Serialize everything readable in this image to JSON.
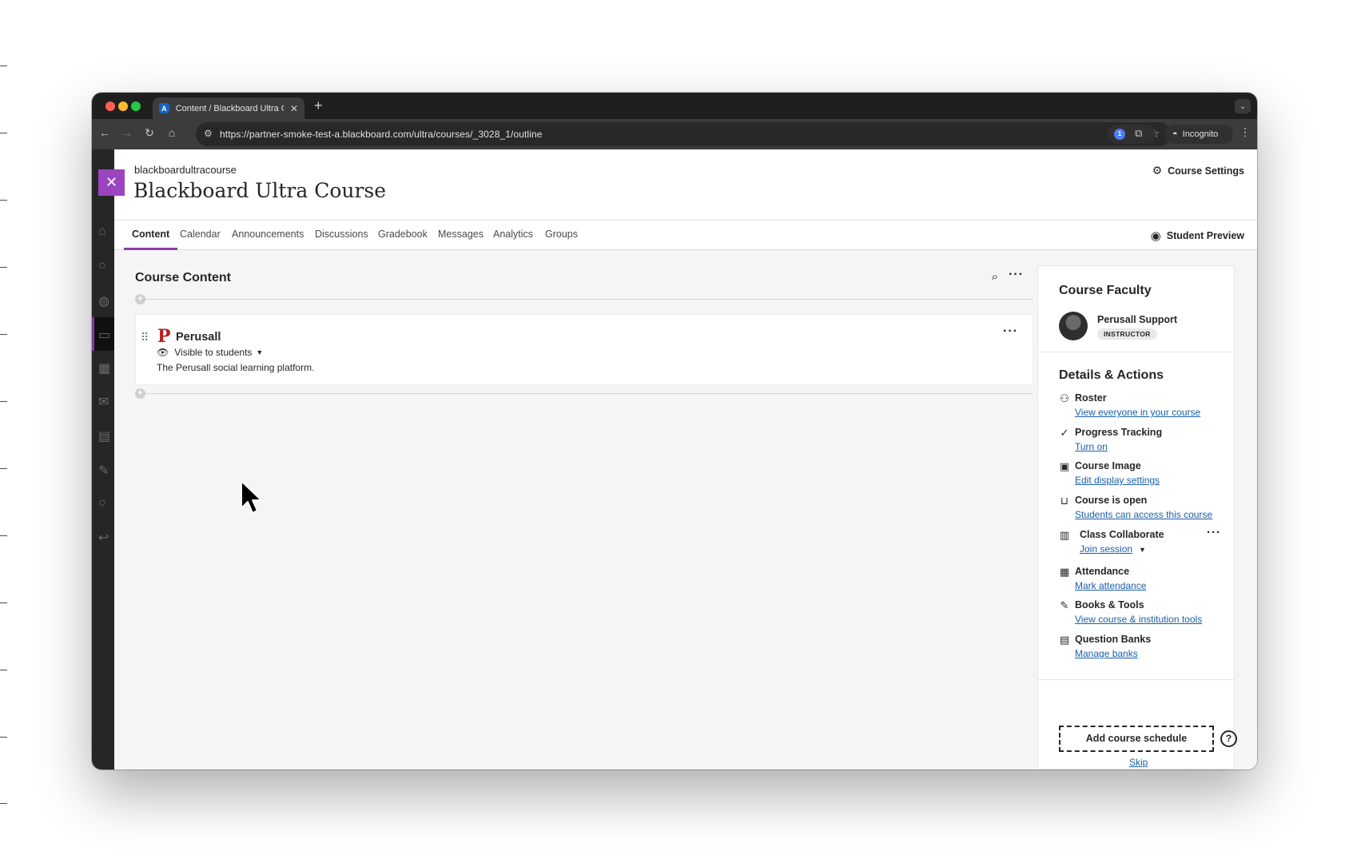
{
  "browser": {
    "tab_title": "Content / Blackboard Ultra Co",
    "tab_favicon_letter": "A",
    "new_tab_glyph": "+",
    "url": "https://partner-smoke-test-a.blackboard.com/ultra/courses/_3028_1/outline",
    "incognito_label": "Incognito",
    "icons": [
      "back-icon",
      "forward-icon",
      "reload-icon",
      "home-icon",
      "site-info-icon",
      "star-icon",
      "extension-icon",
      "incognito-icon",
      "menu-icon"
    ]
  },
  "course": {
    "id": "blackboardultracourse",
    "title": "Blackboard Ultra Course",
    "settings_label": "Course Settings",
    "preview_label": "Student Preview",
    "tabs": [
      {
        "label": "Content"
      },
      {
        "label": "Calendar"
      },
      {
        "label": "Announcements"
      },
      {
        "label": "Discussions"
      },
      {
        "label": "Gradebook"
      },
      {
        "label": "Messages"
      },
      {
        "label": "Analytics"
      },
      {
        "label": "Groups"
      }
    ],
    "active_tab": "Content"
  },
  "content": {
    "heading": "Course Content",
    "items": [
      {
        "title": "Perusall",
        "logo_letter": "P",
        "visibility": "Visible to students",
        "description": "The Perusall social learning platform."
      }
    ]
  },
  "sidebar": {
    "faculty_heading": "Course Faculty",
    "faculty": {
      "name": "Perusall Support",
      "role": "INSTRUCTOR"
    },
    "details_heading": "Details & Actions",
    "actions": [
      {
        "title": "Roster",
        "link": "View everyone in your course",
        "icon": "roster-icon"
      },
      {
        "title": "Progress Tracking",
        "link": "Turn on",
        "icon": "check-circle-icon"
      },
      {
        "title": "Course Image",
        "link": "Edit display settings",
        "icon": "image-icon"
      },
      {
        "title": "Course is open",
        "link": "Students can access this course",
        "icon": "unlock-icon"
      },
      {
        "title": "Class Collaborate",
        "link": "Join session",
        "icon": "collaborate-icon"
      },
      {
        "title": "Attendance",
        "link": "Mark attendance",
        "icon": "attendance-icon"
      },
      {
        "title": "Books & Tools",
        "link": "View course & institution tools",
        "icon": "tools-icon"
      },
      {
        "title": "Question Banks",
        "link": "Manage banks",
        "icon": "question-bank-icon"
      }
    ],
    "schedule_button": "Add course schedule",
    "skip_link": "Skip",
    "help_glyph": "?"
  },
  "colors": {
    "accent_purple": "#8b3fa8",
    "close_tab": "#9c44c0",
    "link_blue": "#1a5fa8",
    "perusall_red": "#b81f1f"
  }
}
